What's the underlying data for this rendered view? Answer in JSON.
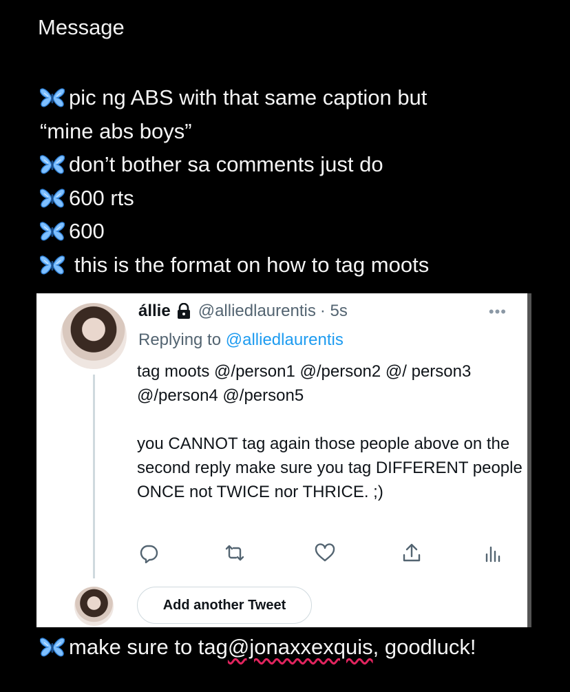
{
  "title": "Message",
  "lines": [
    "pic ng ABS with that same caption but",
    "“mine abs boys”",
    "don’t bother sa comments just do",
    "600 rts",
    "600",
    "this is the format on how to tag moots"
  ],
  "tweet": {
    "name": "állie",
    "handle": "@alliedlaurentis",
    "time": "· 5s",
    "more": "•••",
    "replying_prefix": "Replying to ",
    "replying_handle": "@alliedlaurentis",
    "body_1": "tag moots @/person1 @/person2 @/ person3 @/person4 @/person5",
    "body_2": "you CANNOT tag again those people above on the second reply make sure you tag DIFFERENT people ONCE not TWICE nor THRICE. ;)",
    "add_button": "Add another Tweet"
  },
  "footer": {
    "prefix": "make sure to tag ",
    "mention": "@jonaxxexquis",
    "suffix": ", goodluck!"
  },
  "colors": {
    "background": "#000000",
    "butterfly": "#6fb8ff",
    "twitter_blue": "#1d9bf0",
    "muted": "#536471"
  },
  "icons": [
    "butterfly-icon",
    "lock-icon",
    "reply-icon",
    "retweet-icon",
    "like-icon",
    "share-icon",
    "analytics-icon"
  ]
}
